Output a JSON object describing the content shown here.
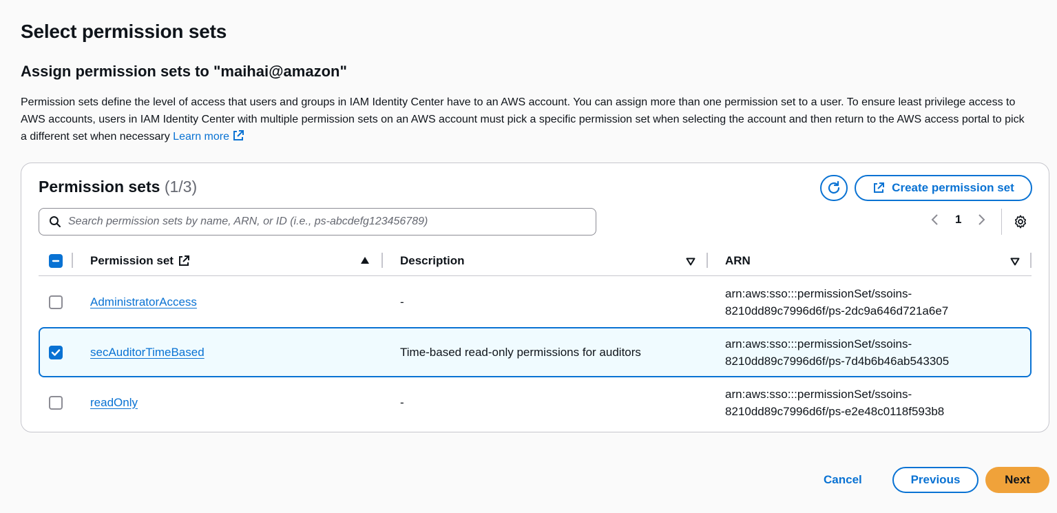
{
  "page": {
    "title": "Select permission sets",
    "subtitle": "Assign permission sets to \"maihai@amazon\"",
    "description": "Permission sets define the level of access that users and groups in IAM Identity Center have to an AWS account. You can assign more than one permission set to a user. To ensure least privilege access to AWS accounts, users in IAM Identity Center with multiple permission sets on an AWS account must pick a specific permission set when selecting the account and then return to the AWS access portal to pick a different set when necessary",
    "learn_more": "Learn more"
  },
  "panel": {
    "title": "Permission sets",
    "count": "(1/3)",
    "create_label": "Create permission set",
    "search_placeholder": "Search permission sets by name, ARN, or ID (i.e., ps-abcdefg123456789)",
    "page_number": "1"
  },
  "table": {
    "columns": [
      "Permission set",
      "Description",
      "ARN"
    ],
    "sort": {
      "column": "Permission set",
      "direction": "ascending"
    },
    "rows": [
      {
        "name": "AdministratorAccess",
        "description": "-",
        "arn_line1": "arn:aws:sso:::permissionSet/ssoins-",
        "arn_line2": "8210dd89c7996d6f/ps-2dc9a646d721a6e7",
        "selected": false
      },
      {
        "name": "secAuditorTimeBased",
        "description": "Time-based read-only permissions for auditors",
        "arn_line1": "arn:aws:sso:::permissionSet/ssoins-",
        "arn_line2": "8210dd89c7996d6f/ps-7d4b6b46ab543305",
        "selected": true
      },
      {
        "name": "readOnly",
        "description": "-",
        "arn_line1": "arn:aws:sso:::permissionSet/ssoins-",
        "arn_line2": "8210dd89c7996d6f/ps-e2e48c0118f593b8",
        "selected": false
      }
    ]
  },
  "footer": {
    "cancel": "Cancel",
    "previous": "Previous",
    "next": "Next"
  },
  "colors": {
    "accent": "#0972d3",
    "primary_button": "#f0a23a",
    "selected_row_bg": "#f0fbff"
  },
  "icons": [
    "external-link-icon",
    "refresh-icon",
    "search-icon",
    "chevron-left-icon",
    "chevron-right-icon",
    "settings-gear-icon",
    "sort-ascending-icon",
    "sort-descending-icon",
    "checkbox-checked-icon",
    "checkbox-indeterminate-icon"
  ]
}
